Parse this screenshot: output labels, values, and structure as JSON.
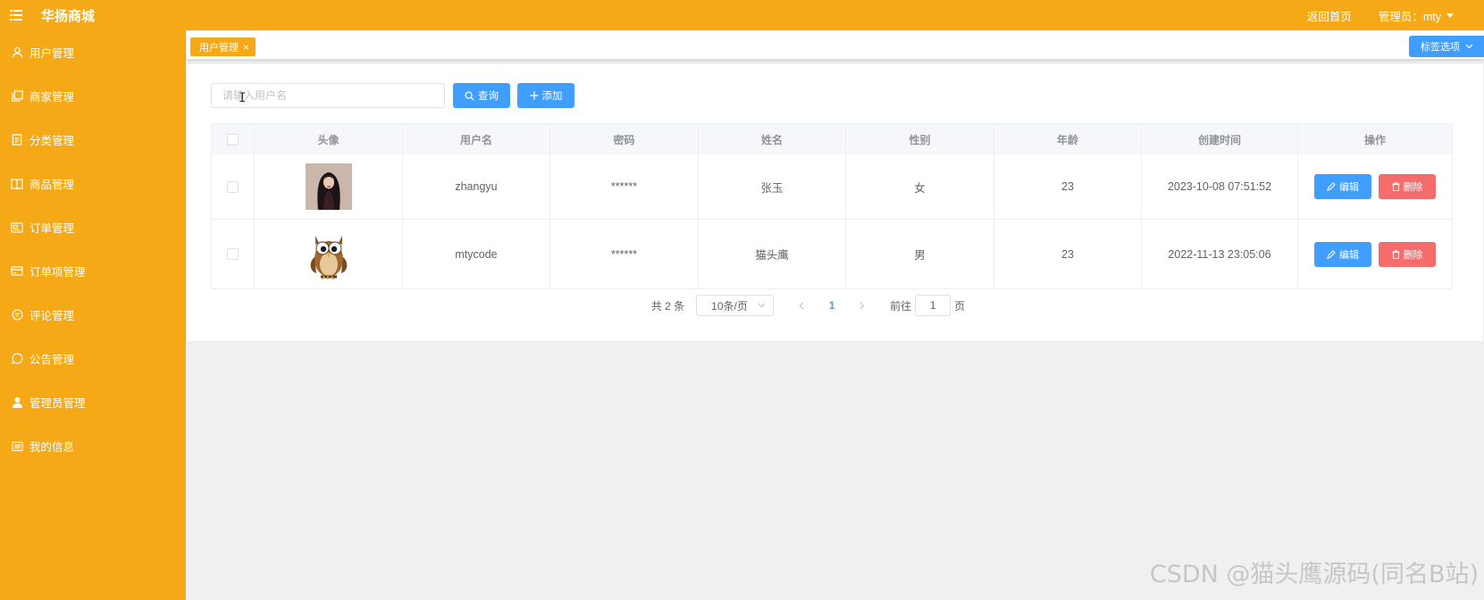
{
  "header": {
    "app_title": "华扬商城",
    "home_link": "返回首页",
    "admin_label": "管理员：mty"
  },
  "sidebar": {
    "items": [
      {
        "label": "用户管理",
        "icon": "user-icon"
      },
      {
        "label": "商家管理",
        "icon": "copy-icon"
      },
      {
        "label": "分类管理",
        "icon": "document-icon"
      },
      {
        "label": "商品管理",
        "icon": "book-icon"
      },
      {
        "label": "订单管理",
        "icon": "ticket-icon"
      },
      {
        "label": "订单项管理",
        "icon": "credit-card-icon"
      },
      {
        "label": "评论管理",
        "icon": "chat-icon"
      },
      {
        "label": "公告管理",
        "icon": "message-icon"
      },
      {
        "label": "管理员管理",
        "icon": "user-solid-icon"
      },
      {
        "label": "我的信息",
        "icon": "menu-icon"
      }
    ]
  },
  "tags": {
    "active_tag": "用户管理",
    "options_label": "标签选项"
  },
  "toolbar": {
    "search_placeholder": "请输入用户名",
    "search_label": "查询",
    "add_label": "添加"
  },
  "table": {
    "columns": [
      "头像",
      "用户名",
      "密码",
      "姓名",
      "性别",
      "年龄",
      "创建时间",
      "操作"
    ],
    "rows": [
      {
        "avatar": "woman-portrait",
        "username": "zhangyu",
        "password": "******",
        "name": "张玉",
        "gender": "女",
        "age": "23",
        "created": "2023-10-08 07:51:52"
      },
      {
        "avatar": "owl-cartoon",
        "username": "mtycode",
        "password": "******",
        "name": "猫头鹰",
        "gender": "男",
        "age": "23",
        "created": "2022-11-13 23:05:06"
      }
    ],
    "edit_label": "编辑",
    "delete_label": "删除"
  },
  "pagination": {
    "total_text": "共 2 条",
    "page_size": "10条/页",
    "current_page": "1",
    "goto_prefix": "前往",
    "goto_value": "1",
    "goto_suffix": "页"
  },
  "watermark": "CSDN @猫头鹰源码(同名B站)",
  "colors": {
    "brand": "#f5a917",
    "primary": "#409eff",
    "danger": "#f56c6c"
  }
}
